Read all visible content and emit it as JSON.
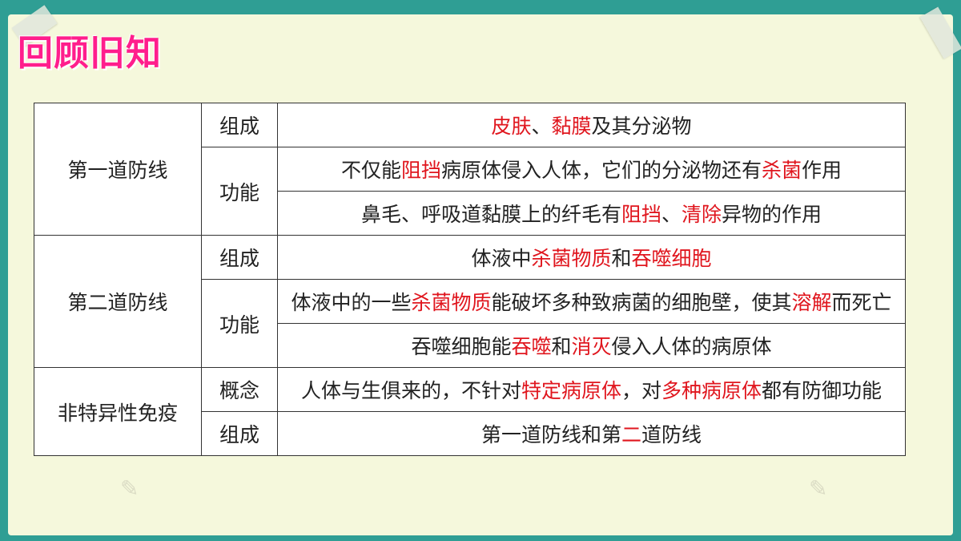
{
  "title": "回顾旧知",
  "rows": {
    "r1": {
      "category": "第一道防线",
      "sub": "组成",
      "segs": [
        "皮肤",
        "、",
        "黏膜",
        "及其分泌物"
      ]
    },
    "r2": {
      "sub": "功能",
      "segs": [
        "不仅能",
        "阻挡",
        "病原体侵入人体，它们的分泌物还有",
        "杀菌",
        "作用"
      ]
    },
    "r3": {
      "segs": [
        "鼻毛、呼吸道黏膜上的纤毛有",
        "阻挡",
        "、",
        "清除",
        "异物的作用"
      ]
    },
    "r4": {
      "category": "第二道防线",
      "sub": "组成",
      "segs": [
        "体液中",
        "杀菌物质",
        "和",
        "吞噬细胞"
      ]
    },
    "r5": {
      "sub": "功能",
      "segs": [
        "体液中的一些",
        "杀菌物质",
        "能破坏多种致病菌的细胞壁，使其",
        "溶解",
        "而死亡"
      ]
    },
    "r6": {
      "segs": [
        "吞噬细胞能",
        "吞噬",
        "和",
        "消灭",
        "侵入人体的病原体"
      ]
    },
    "r7": {
      "category": "非特异性免疫",
      "sub": "概念",
      "segs": [
        "人体与生俱来的，不针对",
        "特定病原体",
        "，对",
        "多种病原体",
        "都有防御功能"
      ]
    },
    "r8": {
      "sub": "组成",
      "segs": [
        "第一道防线和第",
        "二",
        "道防线"
      ]
    }
  },
  "colors": {
    "highlight": "#e0161e",
    "title": "#ff1e8c",
    "frame": "#2f9e94",
    "slide_bg": "#f5f8dc"
  }
}
